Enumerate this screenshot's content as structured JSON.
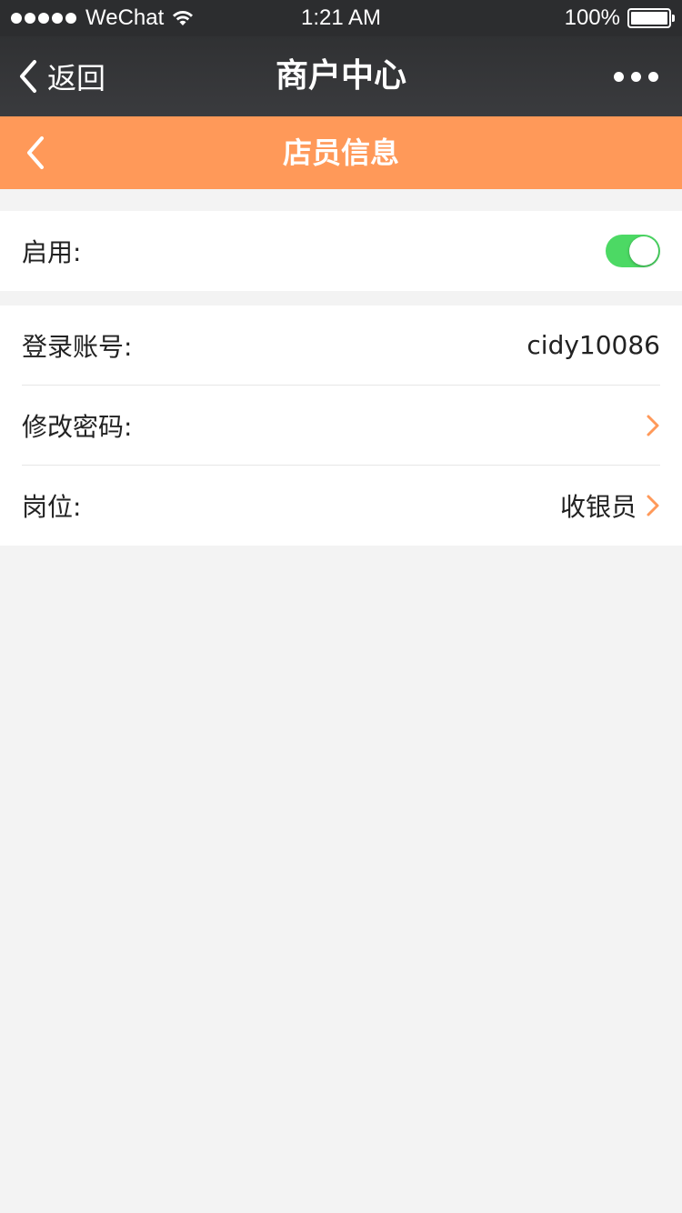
{
  "status_bar": {
    "carrier": "WeChat",
    "time": "1:21 AM",
    "battery": "100%"
  },
  "wechat_nav": {
    "back_label": "返回",
    "title": "商户中心"
  },
  "page_header": {
    "title": "店员信息"
  },
  "groups": [
    {
      "rows": [
        {
          "label": "启用:",
          "toggle_on": true
        }
      ]
    },
    {
      "rows": [
        {
          "label": "登录账号:",
          "value": "cidy10086"
        },
        {
          "label": "修改密码:",
          "value": ""
        },
        {
          "label": "岗位:",
          "value": "收银员"
        }
      ]
    }
  ],
  "colors": {
    "header_orange": "#ff9959",
    "toggle_green": "#4cd964",
    "chevron_orange": "#ff9959",
    "nav_dark": "#303133",
    "background": "#f3f3f3"
  },
  "icons": {
    "status_left": [
      "signal-dots-icon",
      "wifi-icon"
    ],
    "status_right": [
      "battery-icon"
    ],
    "nav": [
      "back-chevron-icon",
      "more-dots-icon"
    ],
    "rows": [
      "chevron-right-icon"
    ]
  }
}
